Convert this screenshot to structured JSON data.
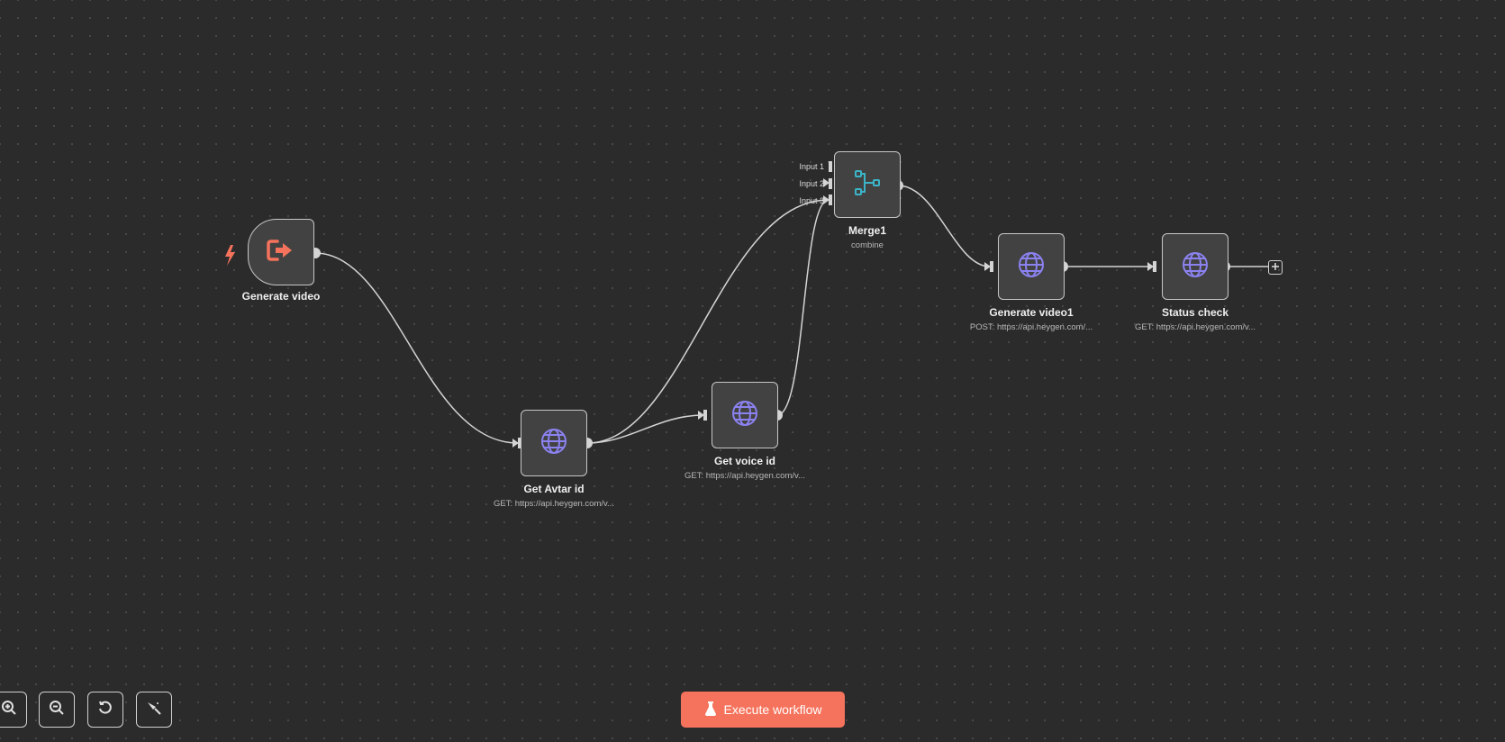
{
  "colors": {
    "canvas": "#2b2b2b",
    "node_bg": "#424242",
    "accent": "#f5735c",
    "http_icon": "#8b82f0",
    "merge_icon": "#3bb4c8"
  },
  "nodes": {
    "generate_video_trigger": {
      "title": "Generate video",
      "icon": "sign-out-icon"
    },
    "get_avatar_id": {
      "title": "Get Avtar id",
      "subtitle": "GET: https://api.heygen.com/v...",
      "icon": "globe-icon"
    },
    "get_voice_id": {
      "title": "Get voice id",
      "subtitle": "GET: https://api.heygen.com/v...",
      "icon": "globe-icon"
    },
    "merge1": {
      "title": "Merge1",
      "subtitle": "combine",
      "icon": "merge-icon",
      "inputs": [
        "Input 1",
        "Input 2",
        "Input 3"
      ]
    },
    "generate_video1": {
      "title": "Generate video1",
      "subtitle": "POST: https://api.heygen.com/...",
      "icon": "globe-icon"
    },
    "status_check": {
      "title": "Status check",
      "subtitle": "GET: https://api.heygen.com/v...",
      "icon": "globe-icon"
    }
  },
  "controls": {
    "zoom_in": "zoom-in-icon",
    "zoom_out": "zoom-out-icon",
    "reset": "undo-icon",
    "tidy": "broom-icon"
  },
  "execute_button": {
    "label": "Execute workflow",
    "icon": "flask-icon"
  }
}
